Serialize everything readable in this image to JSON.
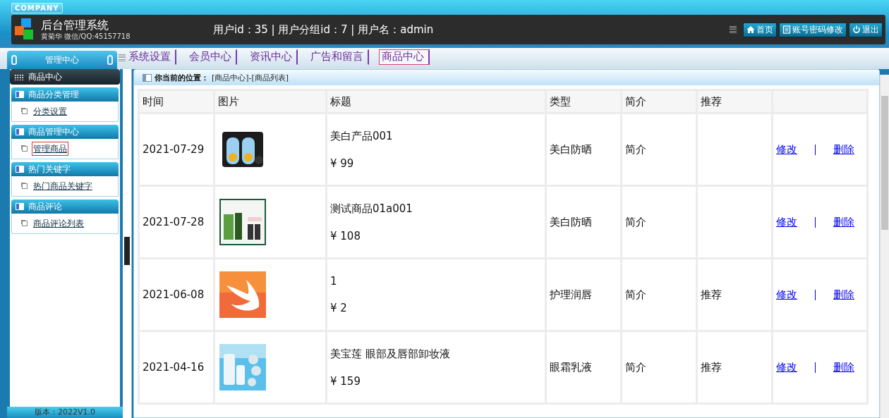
{
  "header": {
    "company": "COMPANY",
    "title": "后台管理系统",
    "subtitle": "黄菊华 微信/QQ:45157718",
    "user_info": "用户id：35 | 用户分组id：7 | 用户名：admin",
    "buttons": [
      {
        "label": "首页",
        "kind": "home"
      },
      {
        "label": "账号密码修改",
        "kind": "account"
      },
      {
        "label": "退出",
        "kind": "power"
      }
    ]
  },
  "nav": {
    "panel_title": "管理中心",
    "tabs": [
      {
        "label": "系统设置",
        "selected": false
      },
      {
        "label": "会员中心",
        "selected": false
      },
      {
        "label": "资讯中心",
        "selected": false
      },
      {
        "label": "广告和留言",
        "selected": false
      },
      {
        "label": "商品中心",
        "selected": true
      }
    ]
  },
  "sidebar": {
    "section": "商品中心",
    "groups": [
      {
        "title": "商品分类管理",
        "links": [
          {
            "label": "分类设置",
            "selected": false
          }
        ]
      },
      {
        "title": "商品管理中心",
        "links": [
          {
            "label": "管理商品",
            "selected": true
          }
        ]
      },
      {
        "title": "热门关键字",
        "links": [
          {
            "label": "热门商品关键字",
            "selected": false
          }
        ]
      },
      {
        "title": "商品评论",
        "links": [
          {
            "label": "商品评论列表",
            "selected": false
          }
        ]
      }
    ],
    "version": "版本：2022V1.0"
  },
  "breadcrumb": {
    "label": "你当前的位置：",
    "path": "[商品中心]-[商品列表]"
  },
  "table": {
    "columns": [
      "时间",
      "图片",
      "标题",
      "类型",
      "简介",
      "推荐"
    ],
    "rows": [
      {
        "time": "2021-07-29",
        "title": "美白产品001",
        "price": "¥ 99",
        "type": "美白防晒",
        "intro": "简介",
        "edit": "修改",
        "delete": "删除"
      },
      {
        "time": "2021-07-28",
        "title": "测试商品01a001",
        "price": "¥ 108",
        "type": "美白防晒",
        "intro": "简介",
        "edit": "修改",
        "delete": "删除"
      },
      {
        "time": "2021-06-08",
        "title": "1",
        "price": "¥ 2",
        "type": "护理润唇",
        "intro": "简介",
        "recommend": "推荐",
        "edit": "修改",
        "delete": "删除"
      },
      {
        "time": "2021-04-16",
        "title": "美宝莲 眼部及唇部卸妆液",
        "price": "¥ 159",
        "type": "眼霜乳液",
        "intro": "简介",
        "recommend": "推荐",
        "edit": "修改",
        "delete": "删除"
      }
    ]
  }
}
